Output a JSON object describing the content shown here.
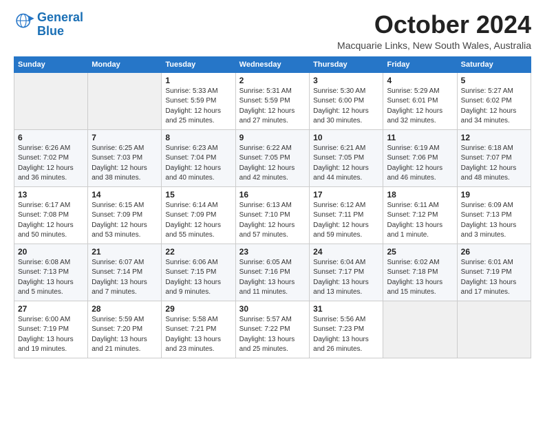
{
  "logo": {
    "line1": "General",
    "line2": "Blue",
    "icon_color": "#2676c8"
  },
  "header": {
    "month": "October 2024",
    "location": "Macquarie Links, New South Wales, Australia"
  },
  "weekdays": [
    "Sunday",
    "Monday",
    "Tuesday",
    "Wednesday",
    "Thursday",
    "Friday",
    "Saturday"
  ],
  "weeks": [
    [
      {
        "day": "",
        "detail": ""
      },
      {
        "day": "",
        "detail": ""
      },
      {
        "day": "1",
        "detail": "Sunrise: 5:33 AM\nSunset: 5:59 PM\nDaylight: 12 hours\nand 25 minutes."
      },
      {
        "day": "2",
        "detail": "Sunrise: 5:31 AM\nSunset: 5:59 PM\nDaylight: 12 hours\nand 27 minutes."
      },
      {
        "day": "3",
        "detail": "Sunrise: 5:30 AM\nSunset: 6:00 PM\nDaylight: 12 hours\nand 30 minutes."
      },
      {
        "day": "4",
        "detail": "Sunrise: 5:29 AM\nSunset: 6:01 PM\nDaylight: 12 hours\nand 32 minutes."
      },
      {
        "day": "5",
        "detail": "Sunrise: 5:27 AM\nSunset: 6:02 PM\nDaylight: 12 hours\nand 34 minutes."
      }
    ],
    [
      {
        "day": "6",
        "detail": "Sunrise: 6:26 AM\nSunset: 7:02 PM\nDaylight: 12 hours\nand 36 minutes."
      },
      {
        "day": "7",
        "detail": "Sunrise: 6:25 AM\nSunset: 7:03 PM\nDaylight: 12 hours\nand 38 minutes."
      },
      {
        "day": "8",
        "detail": "Sunrise: 6:23 AM\nSunset: 7:04 PM\nDaylight: 12 hours\nand 40 minutes."
      },
      {
        "day": "9",
        "detail": "Sunrise: 6:22 AM\nSunset: 7:05 PM\nDaylight: 12 hours\nand 42 minutes."
      },
      {
        "day": "10",
        "detail": "Sunrise: 6:21 AM\nSunset: 7:05 PM\nDaylight: 12 hours\nand 44 minutes."
      },
      {
        "day": "11",
        "detail": "Sunrise: 6:19 AM\nSunset: 7:06 PM\nDaylight: 12 hours\nand 46 minutes."
      },
      {
        "day": "12",
        "detail": "Sunrise: 6:18 AM\nSunset: 7:07 PM\nDaylight: 12 hours\nand 48 minutes."
      }
    ],
    [
      {
        "day": "13",
        "detail": "Sunrise: 6:17 AM\nSunset: 7:08 PM\nDaylight: 12 hours\nand 50 minutes."
      },
      {
        "day": "14",
        "detail": "Sunrise: 6:15 AM\nSunset: 7:09 PM\nDaylight: 12 hours\nand 53 minutes."
      },
      {
        "day": "15",
        "detail": "Sunrise: 6:14 AM\nSunset: 7:09 PM\nDaylight: 12 hours\nand 55 minutes."
      },
      {
        "day": "16",
        "detail": "Sunrise: 6:13 AM\nSunset: 7:10 PM\nDaylight: 12 hours\nand 57 minutes."
      },
      {
        "day": "17",
        "detail": "Sunrise: 6:12 AM\nSunset: 7:11 PM\nDaylight: 12 hours\nand 59 minutes."
      },
      {
        "day": "18",
        "detail": "Sunrise: 6:11 AM\nSunset: 7:12 PM\nDaylight: 13 hours\nand 1 minute."
      },
      {
        "day": "19",
        "detail": "Sunrise: 6:09 AM\nSunset: 7:13 PM\nDaylight: 13 hours\nand 3 minutes."
      }
    ],
    [
      {
        "day": "20",
        "detail": "Sunrise: 6:08 AM\nSunset: 7:13 PM\nDaylight: 13 hours\nand 5 minutes."
      },
      {
        "day": "21",
        "detail": "Sunrise: 6:07 AM\nSunset: 7:14 PM\nDaylight: 13 hours\nand 7 minutes."
      },
      {
        "day": "22",
        "detail": "Sunrise: 6:06 AM\nSunset: 7:15 PM\nDaylight: 13 hours\nand 9 minutes."
      },
      {
        "day": "23",
        "detail": "Sunrise: 6:05 AM\nSunset: 7:16 PM\nDaylight: 13 hours\nand 11 minutes."
      },
      {
        "day": "24",
        "detail": "Sunrise: 6:04 AM\nSunset: 7:17 PM\nDaylight: 13 hours\nand 13 minutes."
      },
      {
        "day": "25",
        "detail": "Sunrise: 6:02 AM\nSunset: 7:18 PM\nDaylight: 13 hours\nand 15 minutes."
      },
      {
        "day": "26",
        "detail": "Sunrise: 6:01 AM\nSunset: 7:19 PM\nDaylight: 13 hours\nand 17 minutes."
      }
    ],
    [
      {
        "day": "27",
        "detail": "Sunrise: 6:00 AM\nSunset: 7:19 PM\nDaylight: 13 hours\nand 19 minutes."
      },
      {
        "day": "28",
        "detail": "Sunrise: 5:59 AM\nSunset: 7:20 PM\nDaylight: 13 hours\nand 21 minutes."
      },
      {
        "day": "29",
        "detail": "Sunrise: 5:58 AM\nSunset: 7:21 PM\nDaylight: 13 hours\nand 23 minutes."
      },
      {
        "day": "30",
        "detail": "Sunrise: 5:57 AM\nSunset: 7:22 PM\nDaylight: 13 hours\nand 25 minutes."
      },
      {
        "day": "31",
        "detail": "Sunrise: 5:56 AM\nSunset: 7:23 PM\nDaylight: 13 hours\nand 26 minutes."
      },
      {
        "day": "",
        "detail": ""
      },
      {
        "day": "",
        "detail": ""
      }
    ]
  ]
}
